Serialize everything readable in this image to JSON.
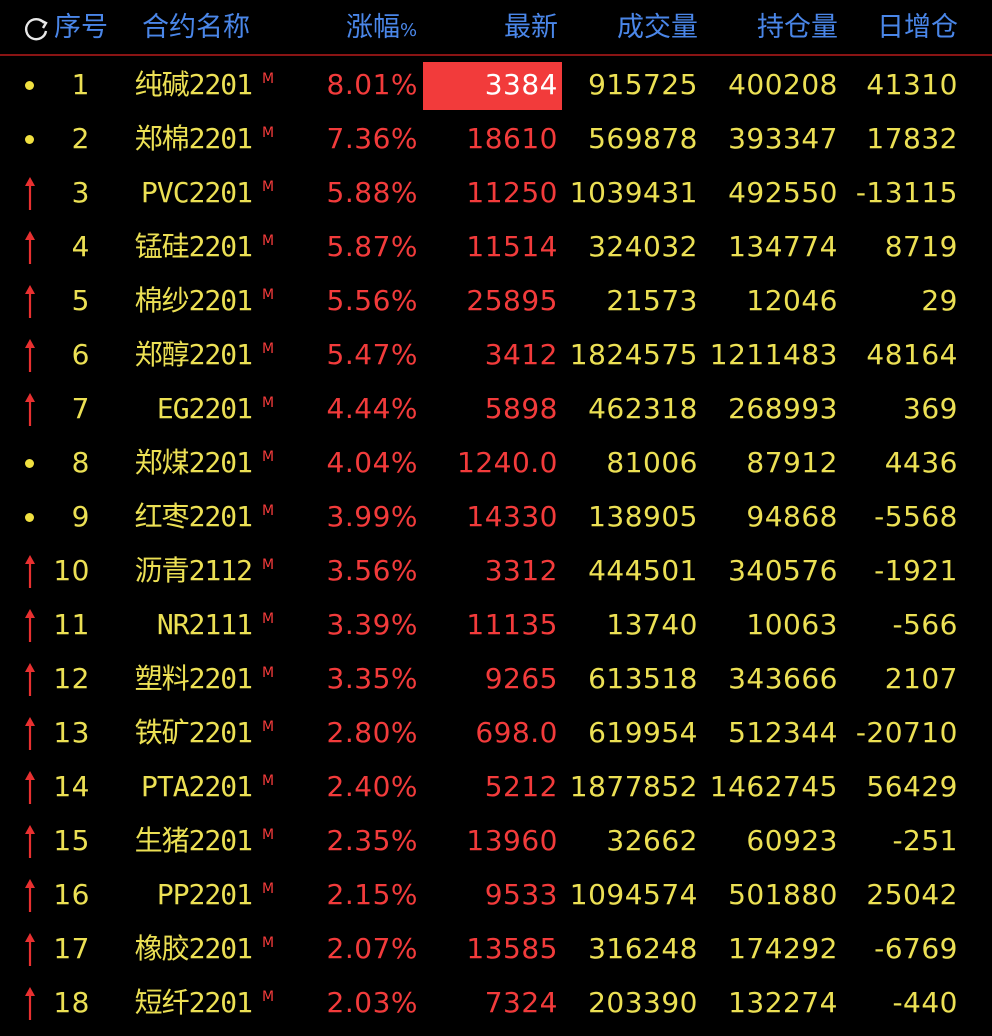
{
  "header": {
    "seq": "序号",
    "name": "合约名称",
    "change": "涨幅",
    "change_pct_symbol": "%",
    "latest": "最新",
    "volume": "成交量",
    "open_interest": "持仓量",
    "daily_oi_change": "日增仓"
  },
  "colors": {
    "accent_blue": "#4a86e8",
    "up_red": "#f23b3b",
    "value_yellow": "#ece054",
    "header_line": "#8a1414"
  },
  "rows": [
    {
      "seq": "1",
      "marker": "dot",
      "name": "纯碱2201",
      "tag": "M",
      "change": "8.01%",
      "latest": "3384",
      "volume": "915725",
      "oi": "400208",
      "doi": "41310",
      "highlight": true
    },
    {
      "seq": "2",
      "marker": "dot",
      "name": "郑棉2201",
      "tag": "M",
      "change": "7.36%",
      "latest": "18610",
      "volume": "569878",
      "oi": "393347",
      "doi": "17832"
    },
    {
      "seq": "3",
      "marker": "arrow",
      "name": "PVC2201",
      "tag": "M",
      "change": "5.88%",
      "latest": "11250",
      "volume": "1039431",
      "oi": "492550",
      "doi": "-13115"
    },
    {
      "seq": "4",
      "marker": "arrow",
      "name": "锰硅2201",
      "tag": "M",
      "change": "5.87%",
      "latest": "11514",
      "volume": "324032",
      "oi": "134774",
      "doi": "8719"
    },
    {
      "seq": "5",
      "marker": "arrow",
      "name": "棉纱2201",
      "tag": "M",
      "change": "5.56%",
      "latest": "25895",
      "volume": "21573",
      "oi": "12046",
      "doi": "29"
    },
    {
      "seq": "6",
      "marker": "arrow",
      "name": "郑醇2201",
      "tag": "M",
      "change": "5.47%",
      "latest": "3412",
      "volume": "1824575",
      "oi": "1211483",
      "doi": "48164"
    },
    {
      "seq": "7",
      "marker": "arrow",
      "name": "EG2201",
      "tag": "M",
      "change": "4.44%",
      "latest": "5898",
      "volume": "462318",
      "oi": "268993",
      "doi": "369"
    },
    {
      "seq": "8",
      "marker": "dot",
      "name": "郑煤2201",
      "tag": "M",
      "change": "4.04%",
      "latest": "1240.0",
      "volume": "81006",
      "oi": "87912",
      "doi": "4436"
    },
    {
      "seq": "9",
      "marker": "dot",
      "name": "红枣2201",
      "tag": "M",
      "change": "3.99%",
      "latest": "14330",
      "volume": "138905",
      "oi": "94868",
      "doi": "-5568"
    },
    {
      "seq": "10",
      "marker": "arrow",
      "name": "沥青2112",
      "tag": "M",
      "change": "3.56%",
      "latest": "3312",
      "volume": "444501",
      "oi": "340576",
      "doi": "-1921"
    },
    {
      "seq": "11",
      "marker": "arrow",
      "name": "NR2111",
      "tag": "M",
      "change": "3.39%",
      "latest": "11135",
      "volume": "13740",
      "oi": "10063",
      "doi": "-566"
    },
    {
      "seq": "12",
      "marker": "arrow",
      "name": "塑料2201",
      "tag": "M",
      "change": "3.35%",
      "latest": "9265",
      "volume": "613518",
      "oi": "343666",
      "doi": "2107"
    },
    {
      "seq": "13",
      "marker": "arrow",
      "name": "铁矿2201",
      "tag": "M",
      "change": "2.80%",
      "latest": "698.0",
      "volume": "619954",
      "oi": "512344",
      "doi": "-20710"
    },
    {
      "seq": "14",
      "marker": "arrow",
      "name": "PTA2201",
      "tag": "M",
      "change": "2.40%",
      "latest": "5212",
      "volume": "1877852",
      "oi": "1462745",
      "doi": "56429"
    },
    {
      "seq": "15",
      "marker": "arrow",
      "name": "生猪2201",
      "tag": "M",
      "change": "2.35%",
      "latest": "13960",
      "volume": "32662",
      "oi": "60923",
      "doi": "-251"
    },
    {
      "seq": "16",
      "marker": "arrow",
      "name": "PP2201",
      "tag": "M",
      "change": "2.15%",
      "latest": "9533",
      "volume": "1094574",
      "oi": "501880",
      "doi": "25042"
    },
    {
      "seq": "17",
      "marker": "arrow",
      "name": "橡胶2201",
      "tag": "M",
      "change": "2.07%",
      "latest": "13585",
      "volume": "316248",
      "oi": "174292",
      "doi": "-6769"
    },
    {
      "seq": "18",
      "marker": "arrow",
      "name": "短纤2201",
      "tag": "M",
      "change": "2.03%",
      "latest": "7324",
      "volume": "203390",
      "oi": "132274",
      "doi": "-440"
    }
  ]
}
